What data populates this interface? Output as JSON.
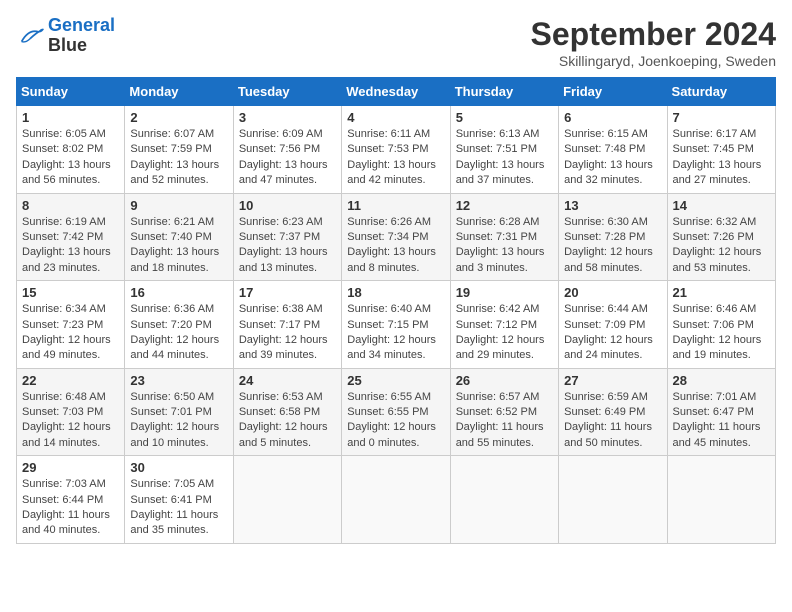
{
  "app": {
    "logo_line1": "General",
    "logo_line2": "Blue"
  },
  "header": {
    "month_year": "September 2024",
    "location": "Skillingaryd, Joenkoeping, Sweden"
  },
  "weekdays": [
    "Sunday",
    "Monday",
    "Tuesday",
    "Wednesday",
    "Thursday",
    "Friday",
    "Saturday"
  ],
  "weeks": [
    [
      {
        "day": "1",
        "detail": "Sunrise: 6:05 AM\nSunset: 8:02 PM\nDaylight: 13 hours\nand 56 minutes."
      },
      {
        "day": "2",
        "detail": "Sunrise: 6:07 AM\nSunset: 7:59 PM\nDaylight: 13 hours\nand 52 minutes."
      },
      {
        "day": "3",
        "detail": "Sunrise: 6:09 AM\nSunset: 7:56 PM\nDaylight: 13 hours\nand 47 minutes."
      },
      {
        "day": "4",
        "detail": "Sunrise: 6:11 AM\nSunset: 7:53 PM\nDaylight: 13 hours\nand 42 minutes."
      },
      {
        "day": "5",
        "detail": "Sunrise: 6:13 AM\nSunset: 7:51 PM\nDaylight: 13 hours\nand 37 minutes."
      },
      {
        "day": "6",
        "detail": "Sunrise: 6:15 AM\nSunset: 7:48 PM\nDaylight: 13 hours\nand 32 minutes."
      },
      {
        "day": "7",
        "detail": "Sunrise: 6:17 AM\nSunset: 7:45 PM\nDaylight: 13 hours\nand 27 minutes."
      }
    ],
    [
      {
        "day": "8",
        "detail": "Sunrise: 6:19 AM\nSunset: 7:42 PM\nDaylight: 13 hours\nand 23 minutes."
      },
      {
        "day": "9",
        "detail": "Sunrise: 6:21 AM\nSunset: 7:40 PM\nDaylight: 13 hours\nand 18 minutes."
      },
      {
        "day": "10",
        "detail": "Sunrise: 6:23 AM\nSunset: 7:37 PM\nDaylight: 13 hours\nand 13 minutes."
      },
      {
        "day": "11",
        "detail": "Sunrise: 6:26 AM\nSunset: 7:34 PM\nDaylight: 13 hours\nand 8 minutes."
      },
      {
        "day": "12",
        "detail": "Sunrise: 6:28 AM\nSunset: 7:31 PM\nDaylight: 13 hours\nand 3 minutes."
      },
      {
        "day": "13",
        "detail": "Sunrise: 6:30 AM\nSunset: 7:28 PM\nDaylight: 12 hours\nand 58 minutes."
      },
      {
        "day": "14",
        "detail": "Sunrise: 6:32 AM\nSunset: 7:26 PM\nDaylight: 12 hours\nand 53 minutes."
      }
    ],
    [
      {
        "day": "15",
        "detail": "Sunrise: 6:34 AM\nSunset: 7:23 PM\nDaylight: 12 hours\nand 49 minutes."
      },
      {
        "day": "16",
        "detail": "Sunrise: 6:36 AM\nSunset: 7:20 PM\nDaylight: 12 hours\nand 44 minutes."
      },
      {
        "day": "17",
        "detail": "Sunrise: 6:38 AM\nSunset: 7:17 PM\nDaylight: 12 hours\nand 39 minutes."
      },
      {
        "day": "18",
        "detail": "Sunrise: 6:40 AM\nSunset: 7:15 PM\nDaylight: 12 hours\nand 34 minutes."
      },
      {
        "day": "19",
        "detail": "Sunrise: 6:42 AM\nSunset: 7:12 PM\nDaylight: 12 hours\nand 29 minutes."
      },
      {
        "day": "20",
        "detail": "Sunrise: 6:44 AM\nSunset: 7:09 PM\nDaylight: 12 hours\nand 24 minutes."
      },
      {
        "day": "21",
        "detail": "Sunrise: 6:46 AM\nSunset: 7:06 PM\nDaylight: 12 hours\nand 19 minutes."
      }
    ],
    [
      {
        "day": "22",
        "detail": "Sunrise: 6:48 AM\nSunset: 7:03 PM\nDaylight: 12 hours\nand 14 minutes."
      },
      {
        "day": "23",
        "detail": "Sunrise: 6:50 AM\nSunset: 7:01 PM\nDaylight: 12 hours\nand 10 minutes."
      },
      {
        "day": "24",
        "detail": "Sunrise: 6:53 AM\nSunset: 6:58 PM\nDaylight: 12 hours\nand 5 minutes."
      },
      {
        "day": "25",
        "detail": "Sunrise: 6:55 AM\nSunset: 6:55 PM\nDaylight: 12 hours\nand 0 minutes."
      },
      {
        "day": "26",
        "detail": "Sunrise: 6:57 AM\nSunset: 6:52 PM\nDaylight: 11 hours\nand 55 minutes."
      },
      {
        "day": "27",
        "detail": "Sunrise: 6:59 AM\nSunset: 6:49 PM\nDaylight: 11 hours\nand 50 minutes."
      },
      {
        "day": "28",
        "detail": "Sunrise: 7:01 AM\nSunset: 6:47 PM\nDaylight: 11 hours\nand 45 minutes."
      }
    ],
    [
      {
        "day": "29",
        "detail": "Sunrise: 7:03 AM\nSunset: 6:44 PM\nDaylight: 11 hours\nand 40 minutes."
      },
      {
        "day": "30",
        "detail": "Sunrise: 7:05 AM\nSunset: 6:41 PM\nDaylight: 11 hours\nand 35 minutes."
      },
      {
        "day": "",
        "detail": ""
      },
      {
        "day": "",
        "detail": ""
      },
      {
        "day": "",
        "detail": ""
      },
      {
        "day": "",
        "detail": ""
      },
      {
        "day": "",
        "detail": ""
      }
    ]
  ]
}
